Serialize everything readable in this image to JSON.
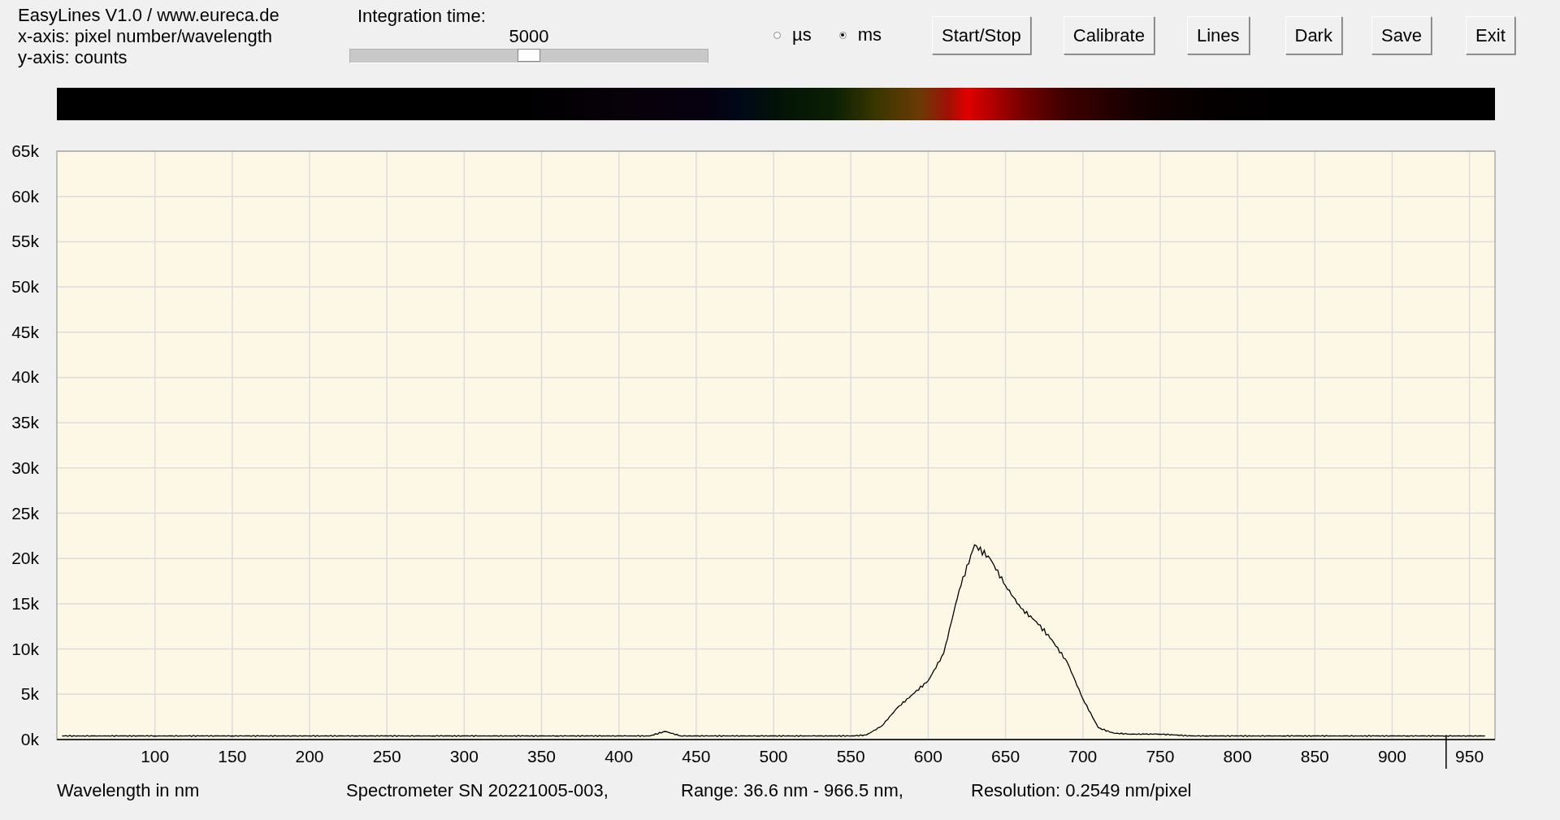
{
  "header": {
    "lines": [
      "EasyLines V1.0 / www.eureca.de",
      "x-axis: pixel number/wavelength",
      "y-axis: counts"
    ]
  },
  "integration": {
    "label": "Integration time:",
    "value": "5000",
    "level": 0.5
  },
  "units": [
    {
      "label": "µs",
      "selected": false
    },
    {
      "label": "ms",
      "selected": true
    }
  ],
  "buttons": [
    "Start/Stop",
    "Calibrate",
    "Lines",
    "Dark",
    "Save",
    "Exit"
  ],
  "chart": {
    "chart_data": {
      "type": "line",
      "xlabel": "Wavelength in nm",
      "xlim": [
        36.6,
        966.5
      ],
      "ylim": [
        0,
        65000
      ],
      "xticks": [
        100,
        150,
        200,
        250,
        300,
        350,
        400,
        450,
        500,
        550,
        600,
        650,
        700,
        750,
        800,
        850,
        900,
        950
      ],
      "yticks": [
        {
          "value": 0,
          "label": "0k"
        },
        {
          "value": 5000,
          "label": "5k"
        },
        {
          "value": 10000,
          "label": "10k"
        },
        {
          "value": 15000,
          "label": "15k"
        },
        {
          "value": 20000,
          "label": "20k"
        },
        {
          "value": 25000,
          "label": "25k"
        },
        {
          "value": 30000,
          "label": "30k"
        },
        {
          "value": 35000,
          "label": "35k"
        },
        {
          "value": 40000,
          "label": "40k"
        },
        {
          "value": 45000,
          "label": "45k"
        },
        {
          "value": 50000,
          "label": "50k"
        },
        {
          "value": 55000,
          "label": "55k"
        },
        {
          "value": 60000,
          "label": "60k"
        },
        {
          "value": 65000,
          "label": "65k"
        }
      ],
      "x": [
        40,
        50,
        60,
        70,
        80,
        90,
        100,
        110,
        120,
        130,
        140,
        150,
        160,
        170,
        180,
        190,
        200,
        210,
        220,
        230,
        240,
        250,
        260,
        270,
        280,
        290,
        300,
        310,
        320,
        330,
        340,
        350,
        360,
        370,
        380,
        390,
        400,
        410,
        420,
        430,
        440,
        450,
        460,
        470,
        480,
        490,
        500,
        510,
        520,
        530,
        540,
        550,
        560,
        570,
        580,
        590,
        600,
        610,
        620,
        630,
        640,
        650,
        660,
        670,
        680,
        690,
        700,
        710,
        720,
        730,
        740,
        750,
        760,
        770,
        780,
        790,
        800,
        810,
        820,
        830,
        840,
        850,
        860,
        870,
        880,
        890,
        900,
        910,
        920,
        930,
        940,
        950,
        960
      ],
      "series": [
        {
          "color": "#000000",
          "values": [
            400,
            400,
            400,
            400,
            400,
            400,
            400,
            400,
            400,
            400,
            400,
            400,
            400,
            400,
            400,
            400,
            400,
            400,
            400,
            400,
            400,
            400,
            400,
            400,
            400,
            400,
            400,
            400,
            400,
            400,
            400,
            400,
            400,
            400,
            400,
            400,
            400,
            400,
            400,
            900,
            400,
            400,
            400,
            400,
            400,
            400,
            400,
            400,
            400,
            400,
            400,
            400,
            500,
            1500,
            3500,
            5000,
            6500,
            9500,
            16500,
            21500,
            20000,
            17000,
            14500,
            13000,
            11000,
            8500,
            4500,
            1300,
            700,
            600,
            600,
            600,
            500,
            400,
            400,
            400,
            400,
            400,
            400,
            400,
            400,
            400,
            400,
            400,
            400,
            400,
            400,
            400,
            400,
            400,
            400,
            400,
            400
          ]
        }
      ],
      "grid": true
    }
  },
  "footer": [
    "Spectrometer SN 20221005-003,",
    "Range: 36.6 nm - 966.5 nm,",
    "Resolution: 0.2549 nm/pixel"
  ]
}
